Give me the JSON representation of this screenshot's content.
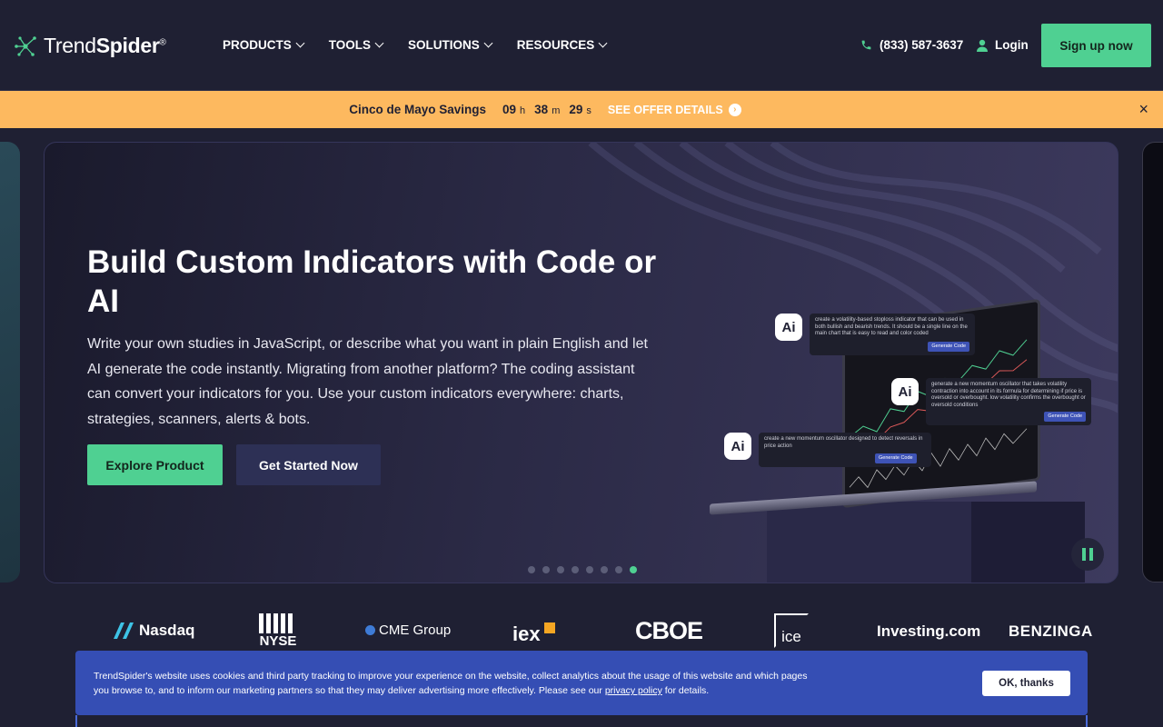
{
  "brand": {
    "name_light": "Trend",
    "name_bold": "Spider",
    "mark": "®"
  },
  "nav": [
    {
      "label": "PRODUCTS"
    },
    {
      "label": "TOOLS"
    },
    {
      "label": "SOLUTIONS"
    },
    {
      "label": "RESOURCES"
    }
  ],
  "header": {
    "phone": "(833) 587-3637",
    "login": "Login",
    "signup": "Sign up now"
  },
  "promo": {
    "title": "Cinco de Mayo Savings",
    "hours": "09",
    "hours_unit": "h",
    "minutes": "38",
    "minutes_unit": "m",
    "seconds": "29",
    "seconds_unit": "s",
    "offer": "SEE OFFER DETAILS",
    "close": "×"
  },
  "hero": {
    "title": "Build Custom Indicators with Code or AI",
    "description": "Write your own studies in JavaScript, or describe what you want in plain English and let AI generate the code instantly. Migrating from another platform? The coding assistant can convert your indicators for you. Use your custom indicators everywhere: charts, strategies, scanners, alerts & bots.",
    "primary_button": "Explore Product",
    "secondary_button": "Get Started Now",
    "ai_label": "Ai",
    "prompts": [
      {
        "text": "create a volatility-based stoploss indicator that can be used in both bullish and bearish trends. It should be a single line on the main chart that is easy to read and color coded",
        "button": "Generate Code"
      },
      {
        "text": "generate a new momentum oscillator that takes volatility contraction into account in its formula for determining if price is oversold or overbought. low volatility confirms the overbought or oversold conditions",
        "button": "Generate Code"
      },
      {
        "text": "create a new momentum oscillator designed to detect reversals in price action",
        "button": "Generate Code"
      }
    ],
    "slides_total": 8,
    "active_slide": 8
  },
  "partners": [
    "Nasdaq",
    "NYSE",
    "CME Group",
    "iex",
    "CBOE",
    "ice",
    "Investing.com",
    "BENZINGA"
  ],
  "cookie": {
    "text_before": "TrendSpider's website uses cookies and third party tracking to improve your experience on the website, collect analytics about the usage of this website and which pages you browse to, and to inform our marketing partners so that they may deliver advertising more effectively. Please see our ",
    "link": "privacy policy",
    "text_after": " for details.",
    "button": "OK, thanks"
  },
  "colors": {
    "accent": "#4fd092",
    "background": "#1f2033",
    "promo": "#fdb95f",
    "cookie": "#354eb4"
  }
}
